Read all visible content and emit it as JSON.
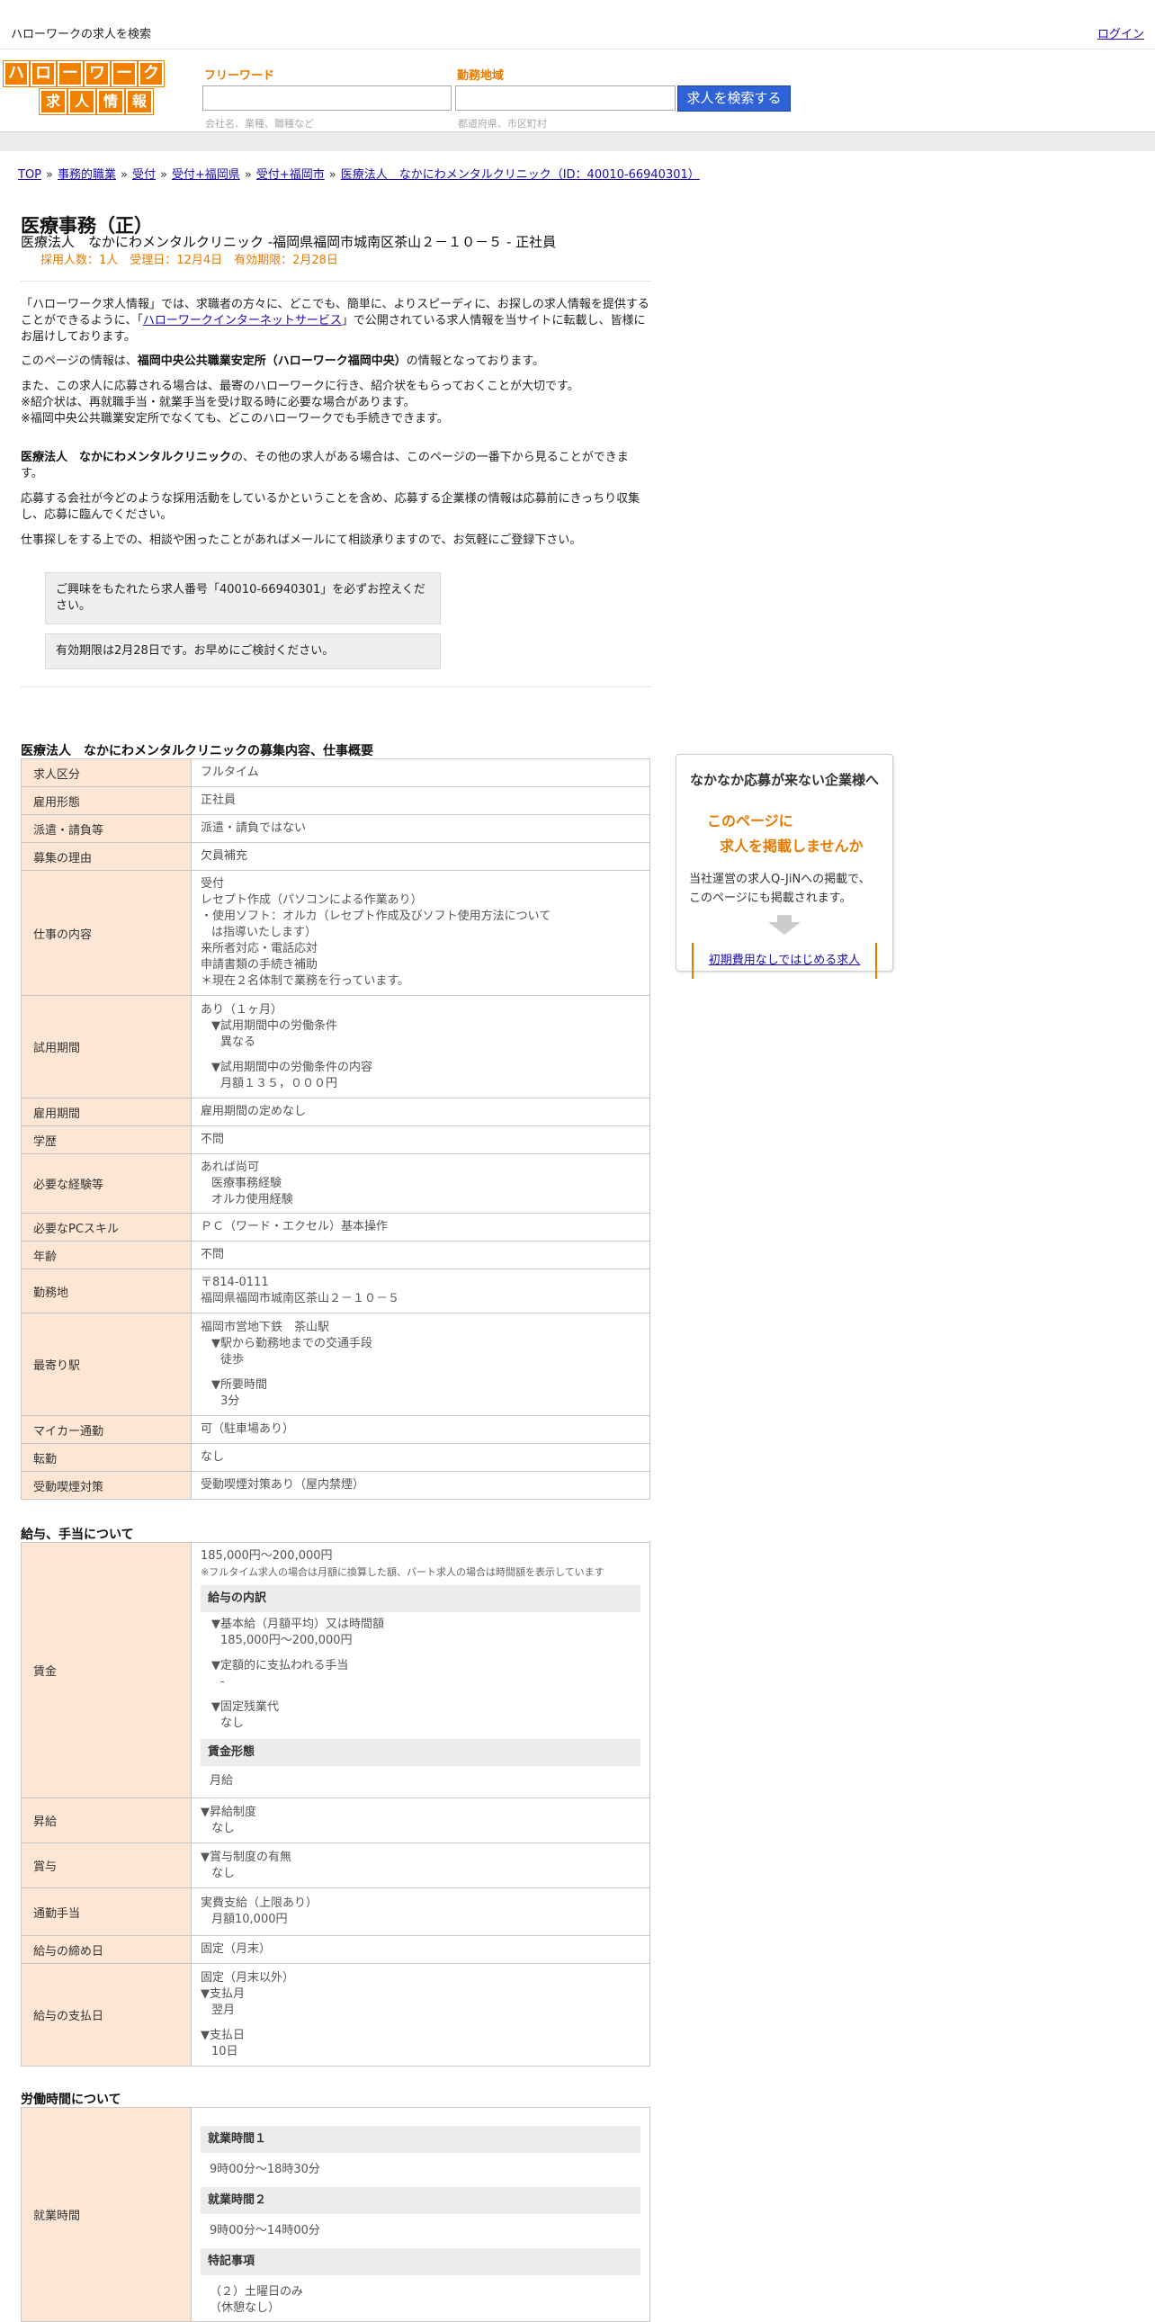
{
  "topbar": {
    "title": "ハローワークの求人を検索",
    "login": "ログイン"
  },
  "logo": {
    "row1": [
      "ハ",
      "ロ",
      "ー",
      "ワ",
      "ー",
      "ク"
    ],
    "row2": [
      "求",
      "人",
      "情",
      "報"
    ]
  },
  "search": {
    "freeword_label": "フリーワード",
    "freeword_hint": "会社名、業種、職種など",
    "area_label": "勤務地域",
    "area_hint": "都道府県、市区町村",
    "button": "求人を検索する"
  },
  "breadcrumb": [
    "TOP",
    "事務的職業",
    "受付",
    "受付+福岡県",
    "受付+福岡市",
    "医療法人　なかにわメンタルクリニック（ID：40010-66940301）"
  ],
  "job": {
    "title": "医療事務（正）",
    "subtitle": "医療法人　なかにわメンタルクリニック -福岡県福岡市城南区茶山２－１０－５ - 正社員",
    "meta": "採用人数：1人　受理日：12月4日　有効期限：2月28日"
  },
  "intro": {
    "p1a": "「ハローワーク求人情報」では、求職者の方々に、どこでも、簡単に、よりスピーディに、お探しの求人情報を提供することができるように、「",
    "p1link": "ハローワークインターネットサービス",
    "p1b": "」で公開されている求人情報を当サイトに転載し、皆様にお届けしております。",
    "p2a": "このページの情報は、",
    "p2b": "福岡中央公共職業安定所（ハローワーク福岡中央）",
    "p2c": "の情報となっております。",
    "p3l1": "また、この求人に応募される場合は、最寄のハローワークに行き、紹介状をもらっておくことが大切です。",
    "p3l2": "※紹介状は、再就職手当・就業手当を受け取る時に必要な場合があります。",
    "p3l3": "※福岡中央公共職業安定所でなくても、どこのハローワークでも手続きできます。",
    "p4a": "医療法人　なかにわメンタルクリニック",
    "p4b": "の、その他の求人がある場合は、このページの一番下から見ることができます。",
    "p5": "応募する会社が今どのような採用活動をしているかということを含め、応募する企業様の情報は応募前にきっちり収集し、応募に臨んでください。",
    "p6": "仕事探しをする上での、相談や困ったことがあればメールにて相談承りますので、お気軽にご登録下さい。"
  },
  "notes": {
    "n1": "ご興味をもたれたら求人番号「40010-66940301」を必ずお控えください。",
    "n2": "有効期限は2月28日です。お早めにご検討ください。"
  },
  "section1": {
    "title": "医療法人　なかにわメンタルクリニックの募集内容、仕事概要",
    "rows": {
      "kubun": [
        "求人区分",
        "フルタイム"
      ],
      "keitai": [
        "雇用形態",
        "正社員"
      ],
      "haken": [
        "派遣・請負等",
        "派遣・請負ではない"
      ],
      "riyu": [
        "募集の理由",
        "欠員補充"
      ],
      "naiyo": [
        "仕事の内容",
        "受付",
        "レセプト作成（パソコンによる作業あり）",
        "・使用ソフト：オルカ（レセプト作成及びソフト使用方法について",
        "は指導いたします）",
        "来所者対応・電話応対",
        "申請書類の手続き補助",
        "＊現在２名体制で業務を行っています。"
      ],
      "shiyo": [
        "試用期間",
        "あり（１ヶ月）",
        "▼試用期間中の労働条件",
        "異なる",
        "▼試用期間中の労働条件の内容",
        "月額１３５，０００円"
      ],
      "koyokikan": [
        "雇用期間",
        "雇用期間の定めなし"
      ],
      "gakureki": [
        "学歴",
        "不問"
      ],
      "keiken": [
        "必要な経験等",
        "あれば尚可",
        "医療事務経験",
        "オルカ使用経験"
      ],
      "pc": [
        "必要なPCスキル",
        "ＰＣ（ワード・エクセル）基本操作"
      ],
      "nenrei": [
        "年齢",
        "不問"
      ],
      "kinmuchi": [
        "勤務地",
        "〒814-0111",
        "福岡県福岡市城南区茶山２－１０－５"
      ],
      "eki": [
        "最寄り駅",
        "福岡市営地下鉄　茶山駅",
        "▼駅から勤務地までの交通手段",
        "徒歩",
        "▼所要時間",
        "3分"
      ],
      "mycar": [
        "マイカー通勤",
        "可（駐車場あり）"
      ],
      "tenkin": [
        "転勤",
        "なし"
      ],
      "judo": [
        "受動喫煙対策",
        "受動喫煙対策あり（屋内禁煙）"
      ]
    }
  },
  "section2": {
    "title": "給与、手当について",
    "chingin_label": "賃金",
    "chingin_amount": "185,000円〜200,000円",
    "chingin_note": "※フルタイム求人の場合は月額に換算した額、パート求人の場合は時間額を表示しています",
    "uchiwake": "給与の内訳",
    "kihon_label": "▼基本給（月額平均）又は時間額",
    "kihon_value": "185,000円〜200,000円",
    "teigaku_label": "▼定額的に支払われる手当",
    "teigaku_value": "-",
    "kotei_label": "▼固定残業代",
    "kotei_value": "なし",
    "keitai_head": "賃金形態",
    "keitai_value": "月給",
    "shokyu": [
      "昇給",
      "▼昇給制度",
      "なし"
    ],
    "shoyo": [
      "賞与",
      "▼賞与制度の有無",
      "なし"
    ],
    "tsukin": [
      "通勤手当",
      "実費支給（上限あり）",
      "月額10,000円"
    ],
    "shime": [
      "給与の締め日",
      "固定（月末）"
    ],
    "shiharai": [
      "給与の支払日",
      "固定（月末以外）",
      "▼支払月",
      "翌月",
      "▼支払日",
      "10日"
    ]
  },
  "section3": {
    "title": "労働時間について",
    "label": "就業時間",
    "h1": "就業時間１",
    "v1": "9時00分〜18時30分",
    "h2": "就業時間２",
    "v2": "9時00分〜14時00分",
    "h3": "特記事項",
    "v3a": "（２）土曜日のみ",
    "v3b": "（休憩なし）"
  },
  "side": {
    "heading": "なかなか応募が来ない企業様へ",
    "offer1": "このページに",
    "offer2": "求人を掲載しませんか",
    "desc1": "当社運営の求人Q-JiNへの掲載で、",
    "desc2": "このページにも掲載されます。",
    "link": "初期費用なしではじめる求人"
  }
}
